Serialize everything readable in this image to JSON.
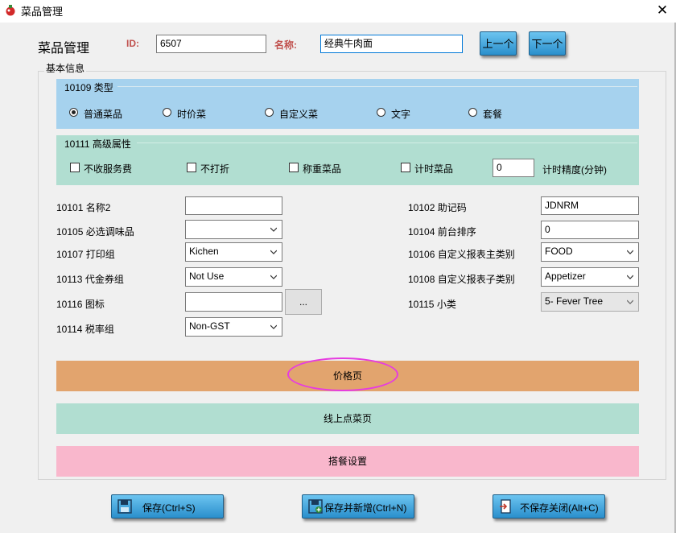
{
  "window": {
    "title": "菜品管理"
  },
  "header": {
    "title": "菜品管理",
    "id_label": "ID:",
    "id_value": "6507",
    "name_label": "名称:",
    "name_value": "经典牛肉面",
    "prev_label": "上一个",
    "next_label": "下一个"
  },
  "group_title": "基本信息",
  "type_panel": {
    "title": "10109 类型",
    "options": [
      "普通菜品",
      "时价菜",
      "自定义菜",
      "文字",
      "套餐"
    ],
    "selected": "普通菜品"
  },
  "advanced_panel": {
    "title": "10111 高级属性",
    "checkboxes": [
      "不收服务费",
      "不打折",
      "称重菜品",
      "计时菜品"
    ],
    "timer_value": "0",
    "timer_label": "计时精度(分钟)"
  },
  "left_fields": {
    "name2": {
      "label": "10101 名称2",
      "value": ""
    },
    "seasoning": {
      "label": "10105 必选调味品",
      "value": ""
    },
    "print_group": {
      "label": "10107 打印组",
      "value": "Kichen"
    },
    "voucher_group": {
      "label": "10113 代金券组",
      "value": "Not Use"
    },
    "icon": {
      "label": "10116 图标",
      "value": "",
      "browse_label": "..."
    },
    "tax_group": {
      "label": "10114 税率组",
      "value": "Non-GST"
    }
  },
  "right_fields": {
    "mnemonic": {
      "label": "10102 助记码",
      "value": "JDNRM"
    },
    "front_sort": {
      "label": "10104 前台排序",
      "value": "0"
    },
    "report_main": {
      "label": "10106 自定义报表主类别",
      "value": "FOOD"
    },
    "report_sub": {
      "label": "10108 自定义报表子类别",
      "value": "Appetizer"
    },
    "subcategory": {
      "label": "10115 小类",
      "value": "5- Fever Tree"
    }
  },
  "bands": {
    "price": {
      "label": "价格页",
      "color": "#e2a46e"
    },
    "online": {
      "label": "线上点菜页",
      "color": "#b1ded1"
    },
    "combo": {
      "label": "搭餐设置",
      "color": "#f9b7cc"
    }
  },
  "footer": {
    "save": "保存(Ctrl+S)",
    "save_new": "保存并新增(Ctrl+N)",
    "close": "不保存关闭(Alt+C)"
  },
  "colors": {
    "accent_label": "#c0504d",
    "highlight": "#e63ce0"
  }
}
